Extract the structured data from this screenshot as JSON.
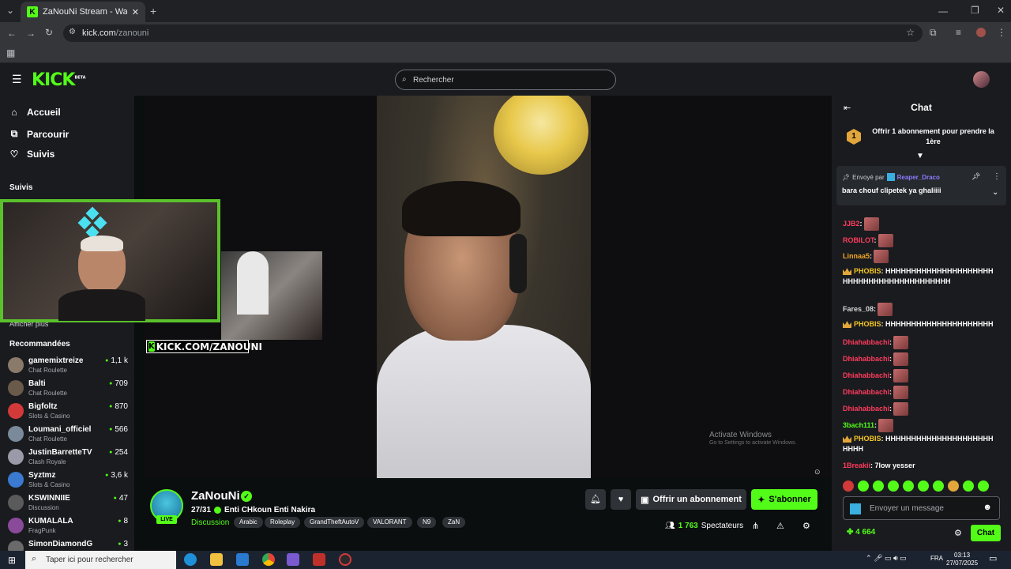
{
  "browser": {
    "tab_title": "ZaNouNi Stream - Watch Live o",
    "url_domain": "kick.com",
    "url_path": "/zanouni"
  },
  "header": {
    "logo": "KICK",
    "logo_badge": "BETA",
    "search_placeholder": "Rechercher"
  },
  "sidebar": {
    "nav": [
      {
        "label": "Accueil",
        "icon": "home-icon"
      },
      {
        "label": "Parcourir",
        "icon": "browse-icon"
      },
      {
        "label": "Suivis",
        "icon": "heart-icon"
      }
    ],
    "followed_heading": "Suivis",
    "show_more": "Afficher plus",
    "recommended_heading": "Recommandées",
    "recommended": [
      {
        "name": "gamemixtreize",
        "category": "Chat Roulette",
        "viewers": "1,1 k",
        "color": "#8a7a6a"
      },
      {
        "name": "Balti",
        "category": "Chat Roulette",
        "viewers": "709",
        "color": "#6a5a4a"
      },
      {
        "name": "Bigfoltz",
        "category": "Slots & Casino",
        "viewers": "870",
        "color": "#d23a3a"
      },
      {
        "name": "Loumani_officiel",
        "category": "Chat Roulette",
        "viewers": "566",
        "color": "#7a8a9a"
      },
      {
        "name": "JustinBarretteTV",
        "category": "Clash Royale",
        "viewers": "254",
        "color": "#9a9aa8"
      },
      {
        "name": "Syztmz",
        "category": "Slots & Casino",
        "viewers": "3,6 k",
        "color": "#3a7ad0"
      },
      {
        "name": "KSWINNIIE",
        "category": "Discussion",
        "viewers": "47",
        "color": "#5a5a5a"
      },
      {
        "name": "KUMALALA",
        "category": "FragPunk",
        "viewers": "8",
        "color": "#8a4a9a"
      },
      {
        "name": "SimonDiamondG",
        "category": "",
        "viewers": "3",
        "color": "#6a6a6a"
      }
    ]
  },
  "video": {
    "watermark": "KICK.COM/ZANOUNI",
    "activate_title": "Activate Windows",
    "activate_sub": "Go to Settings to activate Windows."
  },
  "stream": {
    "channel": "ZaNouNi",
    "live_label": "LIVE",
    "title_prefix": "27/31",
    "title": "Enti CHkoun Enti Nakira",
    "category": "Discussion",
    "tags": [
      "Arabic",
      "Roleplay",
      "GrandTheftAutoV",
      "VALORANT",
      "N9",
      "ZaN"
    ],
    "gift_button": "Offrir un abonnement",
    "subscribe_button": "S'abonner",
    "viewers_count": "1 763",
    "viewers_label": "Spectateurs"
  },
  "chat": {
    "title": "Chat",
    "gift_banner": "Offrir 1 abonnement pour prendre la 1ère",
    "gift_rank": "1",
    "pinned_by_label": "Envoyé par",
    "pinned_user": "Reaper_Draco",
    "pinned_message": "bara chouf clipetek ya ghaliiii",
    "messages": [
      {
        "user": "JJB2",
        "color": "#ff3b5c",
        "text": "",
        "emote": true,
        "crown": false
      },
      {
        "user": "ROBILOT",
        "color": "#ff3b5c",
        "text": "",
        "emote": true,
        "crown": false
      },
      {
        "user": "Linnaa5",
        "color": "#f5a623",
        "text": "",
        "emote": true,
        "crown": false
      },
      {
        "user": "PHOBIS",
        "color": "#f5c623",
        "text": "HHHHHHHHHHHHHHHHHHHHHHHHHHHHHHHHHHHHHHHHHH",
        "emote": false,
        "crown": true
      },
      {
        "user": "Fares_08",
        "color": "#d8d8d8",
        "text": "",
        "emote": true,
        "crown": false
      },
      {
        "user": "PHOBIS",
        "color": "#f5c623",
        "text": "HHHHHHHHHHHHHHHHHHHHH",
        "emote": false,
        "crown": true
      },
      {
        "user": "Dhiahabbachi",
        "color": "#ff3b5c",
        "text": "",
        "emote": true,
        "crown": false
      },
      {
        "user": "Dhiahabbachi",
        "color": "#ff3b5c",
        "text": "",
        "emote": true,
        "crown": false
      },
      {
        "user": "Dhiahabbachi",
        "color": "#ff3b5c",
        "text": "",
        "emote": true,
        "crown": false
      },
      {
        "user": "Dhiahabbachi",
        "color": "#ff3b5c",
        "text": "",
        "emote": true,
        "crown": false
      },
      {
        "user": "Dhiahabbachi",
        "color": "#ff3b5c",
        "text": "",
        "emote": true,
        "crown": false
      },
      {
        "user": "3bach111",
        "color": "#53fc18",
        "text": "",
        "emote": true,
        "crown": false
      },
      {
        "user": "PHOBIS",
        "color": "#f5c623",
        "text": "HHHHHHHHHHHHHHHHHHHHHHHHH",
        "emote": false,
        "crown": true
      },
      {
        "user": "1Breakii",
        "color": "#ff3b5c",
        "text": "7low yesser",
        "emote": false,
        "crown": false
      }
    ],
    "input_placeholder": "Envoyer un message",
    "points": "4 664",
    "send_button": "Chat"
  },
  "taskbar": {
    "search_placeholder": "Taper ici pour rechercher",
    "language": "FRA",
    "time": "03:13",
    "date": "27/07/2025"
  },
  "colors": {
    "accent": "#53fc18",
    "panel": "#191b1f",
    "background": "#0b0e0f"
  }
}
